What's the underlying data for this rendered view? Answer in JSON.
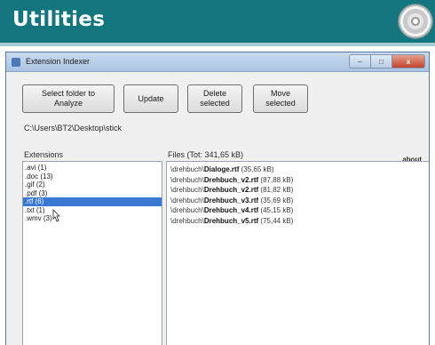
{
  "banner": {
    "title": "Utilities",
    "bg_color": "#13757d",
    "icon": "cd-icon"
  },
  "window": {
    "title": "Extension Indexer",
    "controls": {
      "minimize": "–",
      "maximize": "□",
      "close": "x"
    }
  },
  "toolbar": {
    "select_folder": "Select folder to\nAnalyze",
    "update": "Update",
    "delete": "Delete\nselected",
    "move": "Move\nselected"
  },
  "path": "C:\\Users\\BT2\\Desktop\\stick",
  "extensions": {
    "label": "Extensions",
    "items": [
      {
        "label": ".avi (1)"
      },
      {
        "label": ".doc (13)"
      },
      {
        "label": ".gif (2)"
      },
      {
        "label": ".pdf (3)"
      },
      {
        "label": ".rtf (6)",
        "selected": true
      },
      {
        "label": ".txt (1)"
      },
      {
        "label": ".wmv (3)"
      }
    ]
  },
  "files": {
    "label": "Files  (Tot: 341,65 kB)",
    "about": "about",
    "items": [
      {
        "dir": "\\drehbuch\\",
        "name": "Dialoge.rtf",
        "size": "(35,65 kB)"
      },
      {
        "dir": "\\drehbuch\\",
        "name": "Drehbuch_v2.rtf",
        "size": "(87,88 kB)"
      },
      {
        "dir": "\\drehbuch\\",
        "name": "Drehbuch_v2.rtf",
        "size": "(81,82 kB)"
      },
      {
        "dir": "\\drehbuch\\",
        "name": "Drehbuch_v3.rtf",
        "size": "(35,69 kB)"
      },
      {
        "dir": "\\drehbuch\\",
        "name": "Drehbuch_v4.rtf",
        "size": "(45,15 kB)"
      },
      {
        "dir": "\\drehbuch\\",
        "name": "Drehbuch_v5.rtf",
        "size": "(75,44 kB)"
      }
    ]
  },
  "colors": {
    "selection": "#3a78d6",
    "banner": "#13757d",
    "strip": "#a9cfd2"
  }
}
